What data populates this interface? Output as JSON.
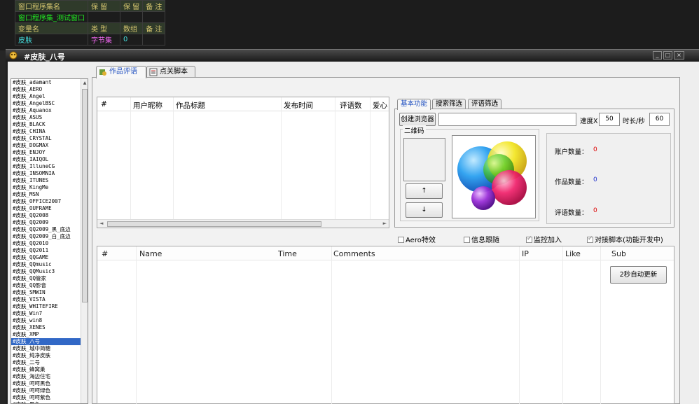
{
  "ide_table": {
    "rows": [
      [
        "窗口程序集名",
        "保 留",
        "保 留",
        "备 注"
      ],
      [
        "窗口程序集_测试窗口",
        "",
        "",
        ""
      ],
      [
        "变量名",
        "类 型",
        "数组",
        "备 注"
      ],
      [
        "皮肤",
        "字节集",
        "0",
        ""
      ]
    ]
  },
  "window": {
    "title": "#皮肤_八号",
    "min": "_",
    "max": "□",
    "close": "×"
  },
  "skins": {
    "selected_index": 37,
    "items": [
      "#皮肤_adamant",
      "#皮肤_AERO",
      "#皮肤_Angel",
      "#皮肤_AngelBSC",
      "#皮肤_Aquanox",
      "#皮肤_ASUS",
      "#皮肤_BLACK",
      "#皮肤_CHINA",
      "#皮肤_CRYSTAL",
      "#皮肤_DOGMAX",
      "#皮肤_ENJOY",
      "#皮肤_IAIQOL",
      "#皮肤_IlluneCG",
      "#皮肤_INSOMNIA",
      "#皮肤_ITUNES",
      "#皮肤_KingMe",
      "#皮肤_MSN",
      "#皮肤_OFFICE2007",
      "#皮肤_OUFRAME",
      "#皮肤_QQ2008",
      "#皮肤_QQ2009",
      "#皮肤_QQ2009_黑_底边",
      "#皮肤_QQ2009_白_底边",
      "#皮肤_QQ2010",
      "#皮肤_QQ2011",
      "#皮肤_QQGAME",
      "#皮肤_QQmusic",
      "#皮肤_QQMusic3",
      "#皮肤_QQ管家",
      "#皮肤_QQ影音",
      "#皮肤_SMWIN",
      "#皮肤_VISTA",
      "#皮肤_WHITEFIRE",
      "#皮肤_Win7",
      "#皮肤_win8",
      "#皮肤_XENES",
      "#皮肤_XMP",
      "#皮肤_八号",
      "#皮肤_城中简糖",
      "#皮肤_纯净皮肤",
      "#皮肤_二号",
      "#皮肤_蜂窝巢",
      "#皮肤_海边住宅",
      "#皮肤_呵呵黑色",
      "#皮肤_呵呵绿色",
      "#皮肤_呵呵紫色",
      "#皮肤_黑色"
    ]
  },
  "tabs": {
    "works_reviews": "作品评语",
    "like_script": "点关脚本"
  },
  "works_table": {
    "columns": [
      "#",
      "用户昵称",
      "作品标题",
      "发布时间",
      "评语数",
      "爱心"
    ]
  },
  "sub_tabs": {
    "basic": "基本功能",
    "search_filter": "搜索筛选",
    "review_filter": "评语筛选"
  },
  "basic": {
    "create_browser": "创建浏览器",
    "url_value": "",
    "speed_label": "速度X",
    "speed_value": "50",
    "duration_label": "时长/秒",
    "duration_value": "60",
    "qr_label": "二维码",
    "up": "↑",
    "down": "↓"
  },
  "stats": {
    "accounts_label": "账户数量：",
    "accounts_value": "0",
    "works_label": "作品数量：",
    "works_value": "0",
    "reviews_label": "评语数量：",
    "reviews_value": "0"
  },
  "checks": {
    "aero": {
      "label": "Aero特效",
      "checked": false
    },
    "trace": {
      "label": "信息跟随",
      "checked": false
    },
    "monitor": {
      "label": "监控加入",
      "checked": true
    },
    "script": {
      "label": "对接脚本(功能开发中)",
      "checked": true
    }
  },
  "comments_table": {
    "columns": [
      "#",
      "Name",
      "Time",
      "Comments",
      "IP",
      "Like",
      "Sub"
    ]
  },
  "refresh_button": "2秒自动更新",
  "colors": {
    "accent": "#2050c0",
    "selected_bg": "#3168c6",
    "red_value": "#dd0000",
    "blue_value": "#2233cc"
  }
}
